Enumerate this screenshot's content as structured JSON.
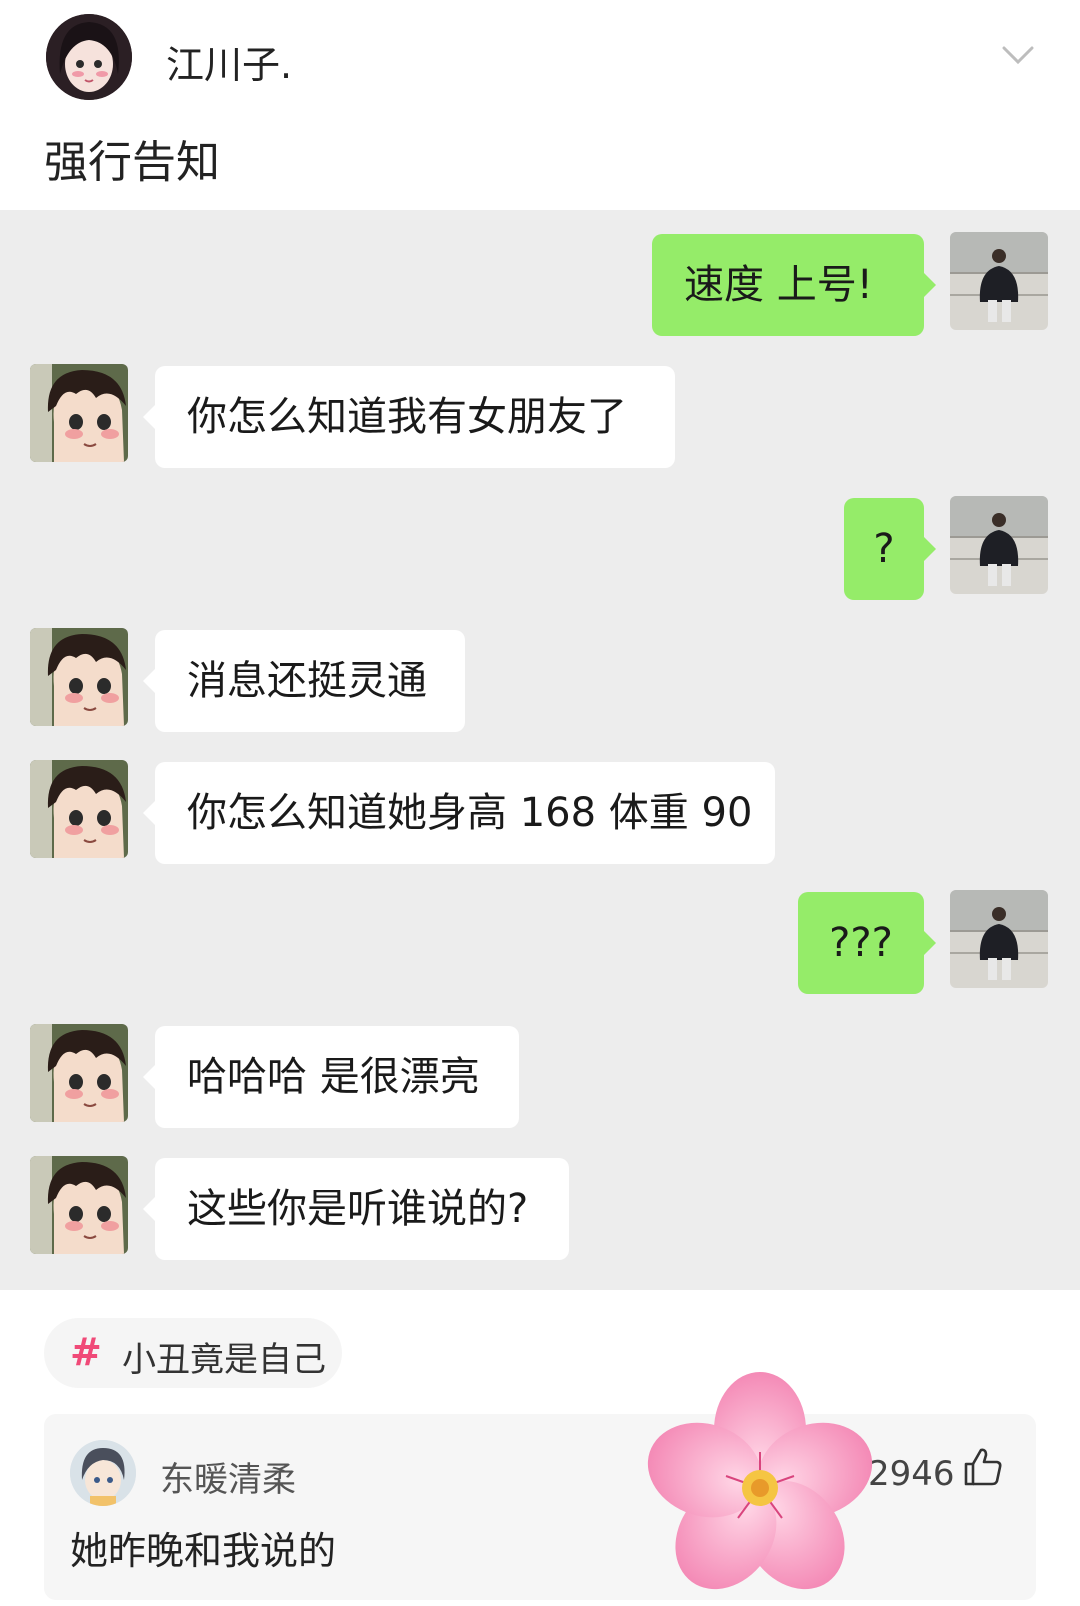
{
  "post": {
    "author": "江川子.",
    "text": "强行告知"
  },
  "chat": {
    "messages": [
      {
        "side": "right",
        "text": "速度 上号!"
      },
      {
        "side": "left",
        "text": "你怎么知道我有女朋友了"
      },
      {
        "side": "right",
        "text": "?"
      },
      {
        "side": "left",
        "text": "消息还挺灵通"
      },
      {
        "side": "left",
        "text": "你怎么知道她身高 168 体重 90"
      },
      {
        "side": "right",
        "text": "???"
      },
      {
        "side": "left",
        "text": "哈哈哈 是很漂亮"
      },
      {
        "side": "left",
        "text": "这些你是听谁说的?"
      }
    ]
  },
  "topic": {
    "hash": "#",
    "label": "小丑竟是自己"
  },
  "comment": {
    "name": "东暖清柔",
    "text": "她昨晚和我说的",
    "likes": "2946"
  },
  "colors": {
    "chat_background": "#ededed",
    "sent_bubble": "#95ec69",
    "received_bubble": "#ffffff",
    "topic_hash": "#f04a78"
  },
  "icons": {
    "collapse": "chevron-down-icon",
    "like": "thumbs-up-icon",
    "decoration": "cherry-blossom-icon"
  }
}
